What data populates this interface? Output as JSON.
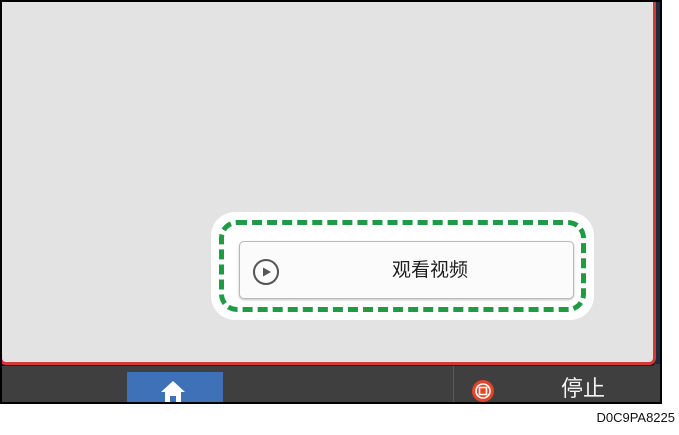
{
  "top_text_fragment": "·······",
  "video_button": {
    "label": "观看视频",
    "icon": "play-circle-icon"
  },
  "bottom_bar": {
    "home_icon": "home-icon",
    "stop_icon": "stop-icon",
    "stop_label": "停止"
  },
  "figure_id": "D0C9PA8225",
  "colors": {
    "panel_border": "#d23a3a",
    "panel_background": "#e3e3e3",
    "highlight_dash": "#1f9a45",
    "home_button": "#3f71b8",
    "stop_icon": "#e2452a",
    "bottom_bar": "#3f3f3f"
  }
}
